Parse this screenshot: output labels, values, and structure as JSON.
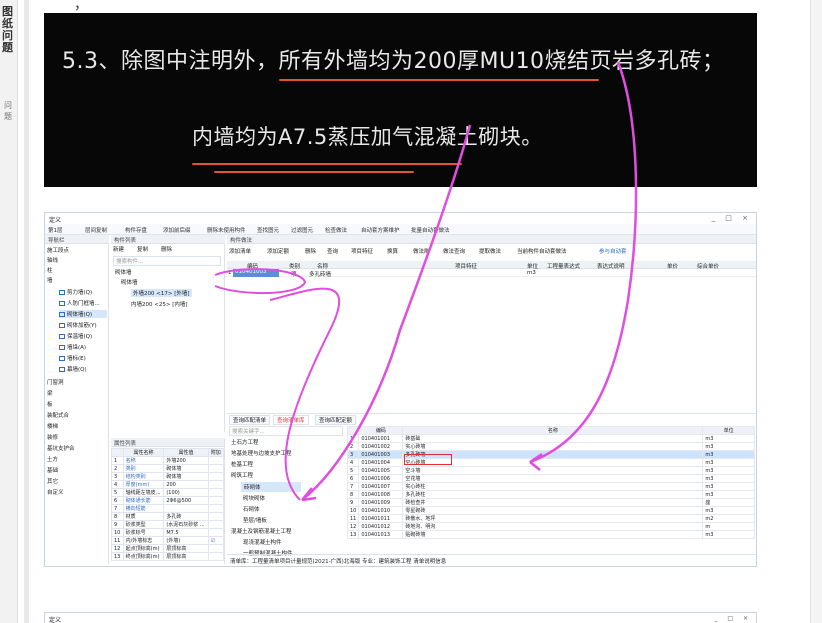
{
  "page_side": {
    "vertical_title": "图纸问题",
    "vertical_sub": "问题"
  },
  "top_cut_text": "，",
  "note": {
    "line1": "5.3、除图中注明外，所有外墙均为200厚MU10烧结页岩多孔砖；",
    "line2": "内墙均为A7.5蒸压加气混凝土砌块。"
  },
  "window": {
    "title": "定义",
    "controls": "_ □ ×",
    "toolbar": [
      "第1层",
      "层间复制",
      "构件存盘",
      "添加前后缀",
      "删除未使用构件",
      "查找图元",
      "过滤图元",
      "检查做法",
      "自动套方案维护",
      "批量自动套做法"
    ],
    "sections": {
      "nav": "导航栏",
      "components": "构件列表",
      "list": "构件做法",
      "props": "属性列表"
    },
    "nav_items": [
      "施工段点",
      "轴线",
      "柱",
      "墙",
      "剪力墙(Q)",
      "人防门框墙...",
      "砌体墙(Q)",
      "砌体加筋(Y)",
      "保温墙(Q)",
      "墙垛(A)",
      "墙标(E)",
      "幕墙(Q)",
      "门窗洞",
      "梁",
      "板",
      "装配式合",
      "楼梯",
      "装修",
      "基坑支护合",
      "土方",
      "基础",
      "其它",
      "自定义"
    ],
    "comp_toolbar": [
      "新建",
      "复制",
      "删除"
    ],
    "comp_search": "搜索构件...",
    "comp_tree": [
      "砌体墙",
      "砌体墙",
      "外墙200 <17> [外墙]",
      "内墙200 <25> [内墙]"
    ],
    "list_toolbar": [
      "添加清单",
      "添加定额",
      "删除",
      "查询",
      "项目特征",
      "换算",
      "做法刷",
      "做法查询",
      "提取做法",
      "当前构件自动套做法",
      "参与自动套"
    ],
    "list_headers": [
      "编码",
      "类别",
      "名称",
      "项目特征",
      "单位",
      "工程量表达式",
      "表达式说明",
      "单价",
      "综合单价"
    ],
    "list_row": {
      "idx": "1",
      "code": "010401003",
      "type": "项",
      "name": "多孔砖墙",
      "unit": "m3"
    },
    "props": {
      "headers": [
        "属性名称",
        "属性值",
        "附加"
      ],
      "rows": [
        [
          "1",
          "名称",
          "外墙200"
        ],
        [
          "2",
          "类别",
          "砌体墙"
        ],
        [
          "3",
          "结构类别",
          "砌体墙"
        ],
        [
          "4",
          "厚度(mm)",
          "200"
        ],
        [
          "5",
          "轴线距左墙皮...",
          "(100)"
        ],
        [
          "6",
          "砌体通长筋",
          "2Φ6@500"
        ],
        [
          "7",
          "横向短筋",
          ""
        ],
        [
          "8",
          "材质",
          "多孔砖"
        ],
        [
          "9",
          "砂浆类型",
          "(水泥石灰砂浆 ..."
        ],
        [
          "10",
          "砂浆标号",
          "M7.5"
        ],
        [
          "11",
          "内/外墙标志",
          "(外墙)"
        ],
        [
          "12",
          "起点顶标高(m)",
          "层顶标高"
        ],
        [
          "13",
          "终点顶标高(m)",
          "层顶标高"
        ]
      ]
    },
    "bottom_tabs": [
      "查询匹配清单",
      "查询清单库",
      "查询匹配定额"
    ],
    "bottom_search": "搜索关键字...",
    "tree_items": [
      "土石方工程",
      "地基处理与边坡支护工程",
      "桩基工程",
      "砌筑工程",
      "砖砌体",
      "砌块砌体",
      "石砌体",
      "垫层/墙板",
      "混凝土及钢筋混凝土工程",
      "现浇混凝土构件",
      "一般预制混凝土构件"
    ],
    "code_headers": [
      "编码",
      "名称",
      "单位"
    ],
    "code_rows": [
      [
        "1",
        "010401001",
        "砖基础",
        "m3"
      ],
      [
        "2",
        "010401002",
        "实心砖墙",
        "m3"
      ],
      [
        "3",
        "010401003",
        "多孔砖墙",
        "m3"
      ],
      [
        "4",
        "010401004",
        "空心砖墙",
        "m3"
      ],
      [
        "5",
        "010401005",
        "空斗墙",
        "m3"
      ],
      [
        "6",
        "010401006",
        "空花墙",
        "m3"
      ],
      [
        "7",
        "010401007",
        "实心砖柱",
        "m3"
      ],
      [
        "8",
        "010401008",
        "多孔砖柱",
        "m3"
      ],
      [
        "9",
        "010401009",
        "砖检查井",
        "座"
      ],
      [
        "10",
        "010401010",
        "零星砌砖",
        "m3"
      ],
      [
        "11",
        "010401011",
        "砖散水、地坪",
        "m2"
      ],
      [
        "12",
        "010401012",
        "砖地沟、明沟",
        "m"
      ],
      [
        "13",
        "010401013",
        "贴砌砖墙",
        "m3"
      ]
    ],
    "status": "清单库：工程量清单项目计量规范(2021-广西)北海版   专业：建筑装饰工程   清单说明信息"
  },
  "next_window": {
    "title": "定义",
    "controls": "_ □ ×"
  },
  "colors": {
    "annotation": "#e04ee0",
    "underline": "#e0542a",
    "highlight": "#d6e7fb",
    "redbox": "#e03030"
  }
}
